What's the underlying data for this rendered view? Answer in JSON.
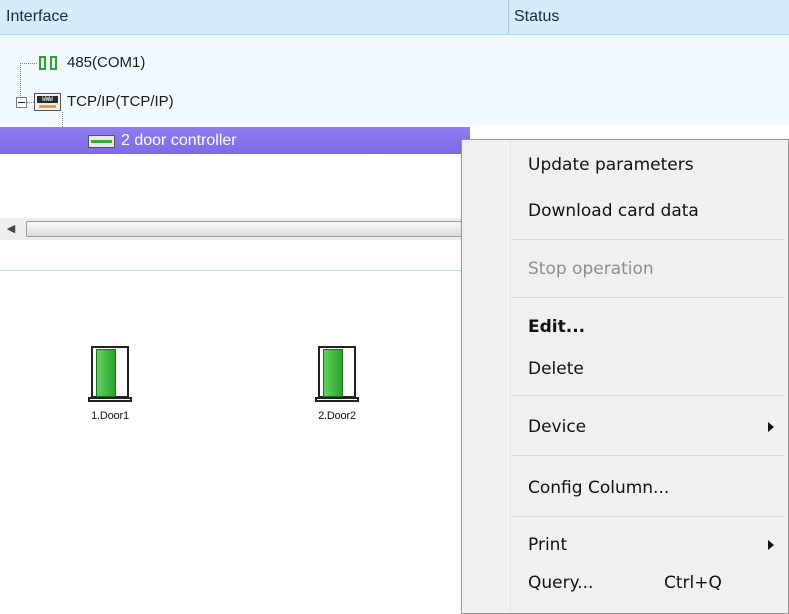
{
  "grid": {
    "columns": {
      "interface": "Interface",
      "status": "Status"
    },
    "tree": {
      "com_node": "485(COM1)",
      "tcp_node": "TCP/IP(TCP/IP)",
      "controller_node": "2 door controller",
      "tcp_icon_text": "WWW"
    }
  },
  "doors": [
    {
      "label": "1.Door1"
    },
    {
      "label": "2.Door2"
    }
  ],
  "context_menu": {
    "update_parameters": "Update parameters",
    "download_card_data": "Download card data",
    "stop_operation": "Stop operation",
    "edit": "Edit...",
    "delete": "Delete",
    "device": "Device",
    "config_column": "Config Column...",
    "print": "Print",
    "query": "Query...",
    "query_shortcut": "Ctrl+Q"
  },
  "colors": {
    "header_bg": "#d6ecfa",
    "selection": "#8f7df0",
    "door_green": "#2ea02e",
    "menu_bg": "#f0f0f0"
  }
}
